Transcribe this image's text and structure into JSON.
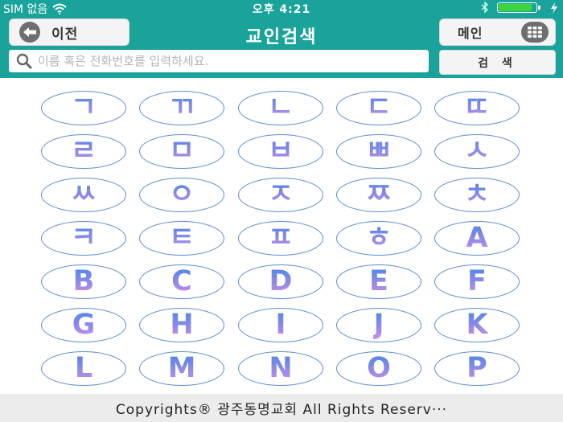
{
  "status": {
    "carrier": "SIM 없음",
    "time": "오후 4:21",
    "battery_level": 0.9,
    "colors": {
      "bar": "#1aa39a",
      "battery_fill": "#3ed43e"
    },
    "icons": [
      "wifi-icon",
      "bluetooth-icon",
      "battery-icon",
      "charging-bolt-icon"
    ]
  },
  "header": {
    "title": "교인검색",
    "back_label": "이전",
    "menu_label": "메인",
    "back_icon": "arrow-left-icon",
    "menu_icon": "grid-menu-icon"
  },
  "search": {
    "placeholder": "이름 혹은 전화번호를 입력하세요.",
    "value": "",
    "button_label": "검 색",
    "icon": "search-icon"
  },
  "keys": [
    "ㄱ",
    "ㄲ",
    "ㄴ",
    "ㄷ",
    "ㄸ",
    "ㄹ",
    "ㅁ",
    "ㅂ",
    "ㅃ",
    "ㅅ",
    "ㅆ",
    "ㅇ",
    "ㅈ",
    "ㅉ",
    "ㅊ",
    "ㅋ",
    "ㅌ",
    "ㅍ",
    "ㅎ",
    "A",
    "B",
    "C",
    "D",
    "E",
    "F",
    "G",
    "H",
    "I",
    "J",
    "K",
    "L",
    "M",
    "N",
    "O",
    "P"
  ],
  "key_colors": {
    "outline": "#5a8fd0",
    "text_top": "#4f86e8",
    "text_bottom": "#cc8ee6"
  },
  "footer": {
    "text": "Copyrights® 광주동명교회 All Rights Reserv···"
  }
}
